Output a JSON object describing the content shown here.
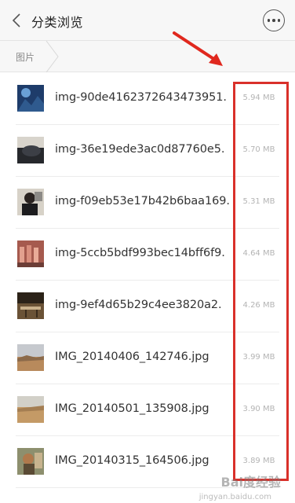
{
  "header": {
    "back_icon": "chevron-left-icon",
    "title": "分类浏览",
    "more_icon": "more-dots-icon"
  },
  "breadcrumb": {
    "items": [
      "图片"
    ]
  },
  "files": [
    {
      "name": "img-90de4162372643473951.",
      "size": "5.94 MB"
    },
    {
      "name": "img-36e19ede3ac0d87760e5.",
      "size": "5.70 MB"
    },
    {
      "name": "img-f09eb53e17b42b6baa169.",
      "size": "5.31 MB"
    },
    {
      "name": "img-5ccb5bdf993bec14bff6f9.",
      "size": "4.64 MB"
    },
    {
      "name": "img-9ef4d65b29c4ee3820a2.",
      "size": "4.26 MB"
    },
    {
      "name": "IMG_20140406_142746.jpg",
      "size": "3.99 MB"
    },
    {
      "name": "IMG_20140501_135908.jpg",
      "size": "3.90 MB"
    },
    {
      "name": "IMG_20140315_164506.jpg",
      "size": "3.89 MB"
    }
  ],
  "annotation": {
    "highlight_color": "#d9302a",
    "arrow_color": "#e0281e"
  },
  "watermark": {
    "text": "Bai度经验",
    "sub": "jingyan.baidu.com"
  }
}
